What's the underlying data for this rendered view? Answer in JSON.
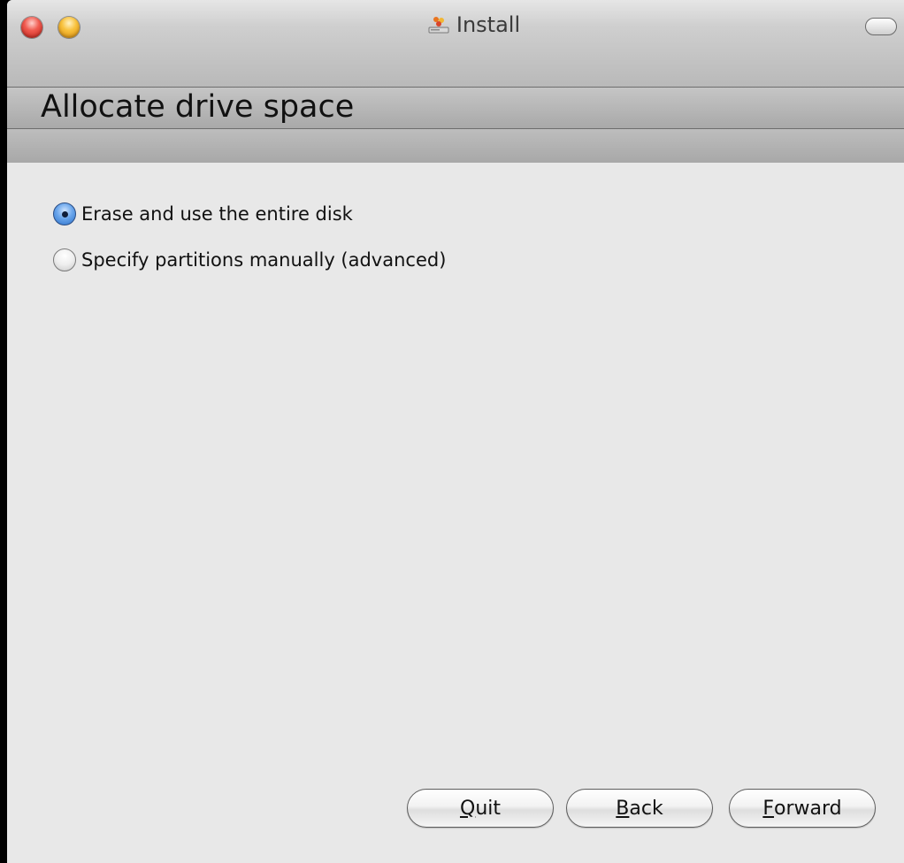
{
  "window": {
    "title": "Install",
    "title_icon": "installer-icon"
  },
  "header": {
    "heading": "Allocate drive space"
  },
  "options": [
    {
      "label": "Erase and use the entire disk",
      "selected": true
    },
    {
      "label": "Specify partitions manually (advanced)",
      "selected": false
    }
  ],
  "buttons": {
    "quit": {
      "mnemonic": "Q",
      "rest": "uit"
    },
    "back": {
      "mnemonic": "B",
      "rest": "ack"
    },
    "forward": {
      "mnemonic": "F",
      "rest": "orward"
    }
  },
  "colors": {
    "close": "#f05a4f",
    "minimize": "#f8c13c",
    "selected_radio": "#2a6fc8"
  }
}
